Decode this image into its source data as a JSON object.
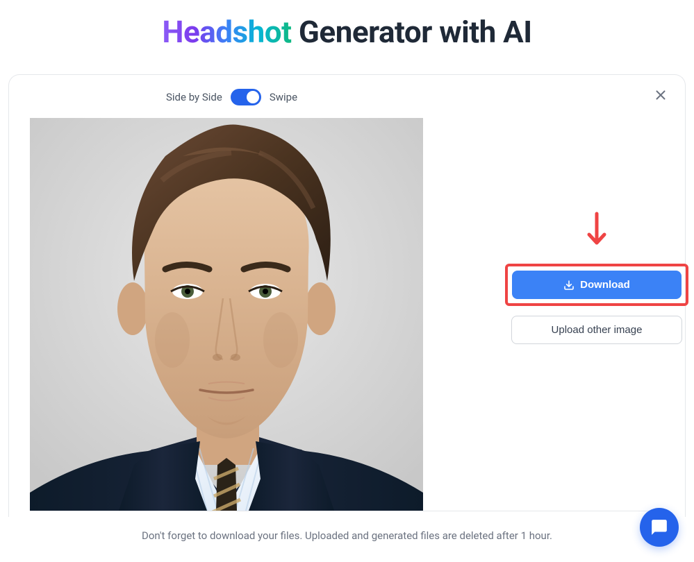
{
  "header": {
    "title_gradient": "Headshot",
    "title_rest": " Generator with AI"
  },
  "viewToggle": {
    "left_label": "Side by Side",
    "right_label": "Swipe"
  },
  "actions": {
    "download_label": "Download",
    "upload_other_label": "Upload other image"
  },
  "footer": {
    "note": "Don't forget to download your files. Uploaded and generated files are deleted after 1 hour."
  }
}
